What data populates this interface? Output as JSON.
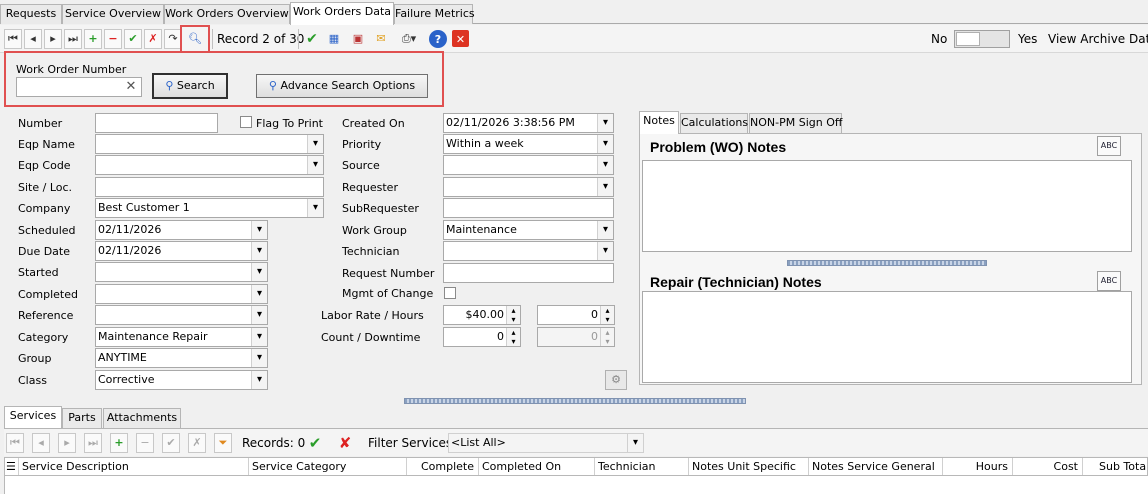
{
  "top_tabs": [
    "Requests",
    "Service Overview",
    "Work Orders Overview",
    "Work Orders Data",
    "Failure Metrics"
  ],
  "toolbar": {
    "record": "Record 2 of 30",
    "toggle_off": "No",
    "toggle_on": "Yes",
    "view_archive": "View Archive Data"
  },
  "search": {
    "label": "Work Order Number",
    "value": "",
    "search_button": "Search",
    "advanced_button": "Advance Search Options"
  },
  "form_left": {
    "number": {
      "label": "Number",
      "value": ""
    },
    "flag_to_print": "Flag To Print",
    "eqp_name": {
      "label": "Eqp Name",
      "value": ""
    },
    "eqp_code": {
      "label": "Eqp Code",
      "value": ""
    },
    "site_loc": {
      "label": "Site / Loc.",
      "value": ""
    },
    "company": {
      "label": "Company",
      "value": "Best Customer 1"
    },
    "scheduled": {
      "label": "Scheduled",
      "value": "02/11/2026"
    },
    "due_date": {
      "label": "Due Date",
      "value": "02/11/2026"
    },
    "started": {
      "label": "Started",
      "value": ""
    },
    "completed": {
      "label": "Completed",
      "value": ""
    },
    "reference": {
      "label": "Reference",
      "value": ""
    },
    "category": {
      "label": "Category",
      "value": "Maintenance Repair"
    },
    "group": {
      "label": "Group",
      "value": "ANYTIME"
    },
    "class": {
      "label": "Class",
      "value": "Corrective"
    }
  },
  "form_mid": {
    "created_on": {
      "label": "Created On",
      "value": "02/11/2026 3:38:56 PM"
    },
    "priority": {
      "label": "Priority",
      "value": "Within a week"
    },
    "source": {
      "label": "Source",
      "value": ""
    },
    "requester": {
      "label": "Requester",
      "value": ""
    },
    "subrequester": {
      "label": "SubRequester",
      "value": ""
    },
    "work_group": {
      "label": "Work Group",
      "value": "Maintenance"
    },
    "technician": {
      "label": "Technician",
      "value": ""
    },
    "request_number": {
      "label": "Request Number",
      "value": ""
    },
    "mgmt_change": {
      "label": "Mgmt of Change"
    },
    "labor_rate": {
      "label": "Labor Rate / Hours",
      "rate": "$40.00",
      "hours": "0"
    },
    "count_downtime": {
      "label": "Count / Downtime",
      "count": "0",
      "downtime": "0"
    }
  },
  "notes": {
    "tabs": [
      "Notes",
      "Calculations",
      "NON-PM Sign Off"
    ],
    "problem_title": "Problem (WO) Notes",
    "repair_title": "Repair (Technician) Notes",
    "spell_label": "ABC"
  },
  "bottom": {
    "tabs": [
      "Services",
      "Parts",
      "Attachments"
    ],
    "records": "Records: 0",
    "filter_label": "Filter Services:",
    "filter_value": "<List All>",
    "columns": [
      "Service Description",
      "Service Category",
      "Complete",
      "Completed On",
      "Technician",
      "Notes Unit Specific",
      "Notes Service General",
      "Hours",
      "Cost",
      "Sub Tota"
    ]
  },
  "colors": {
    "highlight": "#e05050",
    "accent": "#2a62c9"
  }
}
